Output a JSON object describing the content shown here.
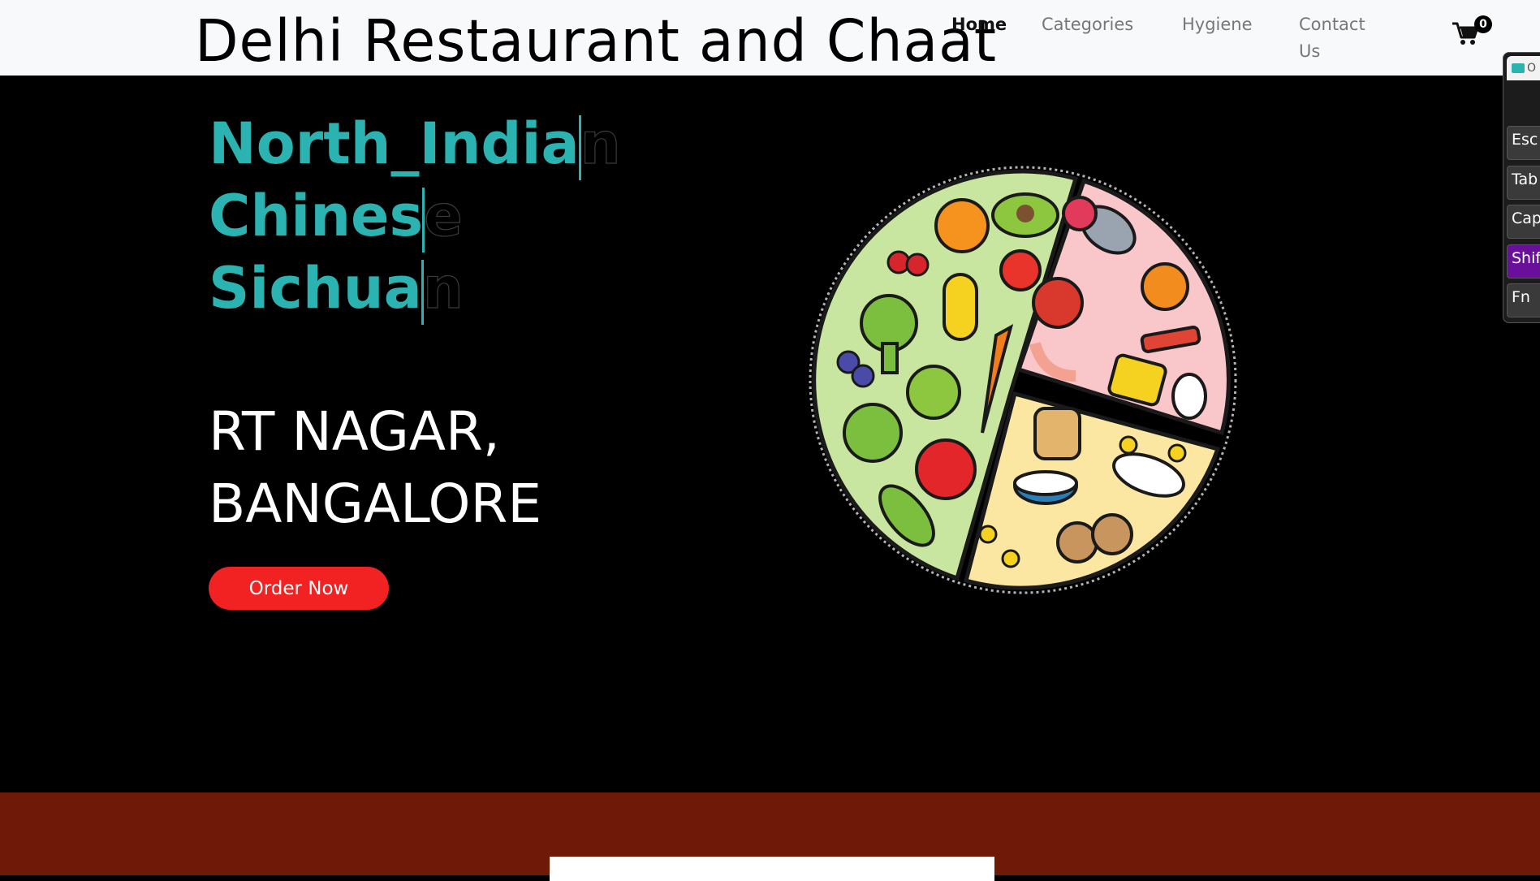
{
  "header": {
    "brand": "Delhi Restaurant and Chaat",
    "nav": {
      "home": "Home",
      "categories": "Categories",
      "hygiene": "Hygiene",
      "contact": "Contact Us"
    },
    "cart_count": "0",
    "cart_icon": "shopping-cart-icon"
  },
  "hero": {
    "cuisines": [
      {
        "typed": "North_India",
        "rest": "n"
      },
      {
        "typed": "Chines",
        "rest": "e"
      },
      {
        "typed": "Sichua",
        "rest": "n"
      }
    ],
    "location_line1": "RT NAGAR,",
    "location_line2": "BANGALORE",
    "order_button": "Order Now",
    "image": "food-plate-illustration",
    "colors": {
      "accent_teal": "#2ab3b1",
      "order_red": "#f22222",
      "band_brown": "#6f1a08"
    }
  },
  "keyboard_widget": {
    "title": "O",
    "keys": [
      "Esc",
      "Tab",
      "Caps",
      "Shift",
      "Fn"
    ]
  }
}
